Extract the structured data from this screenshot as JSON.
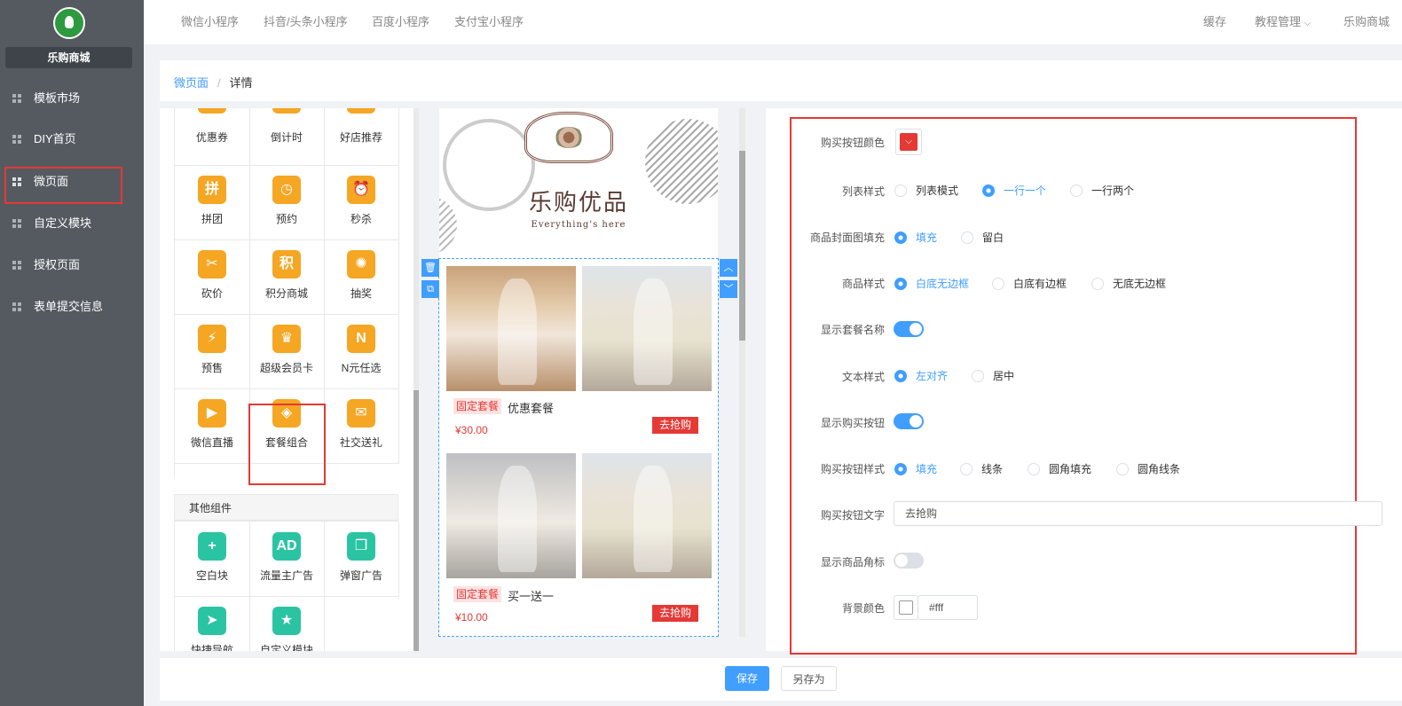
{
  "app": {
    "brand": "乐购商城"
  },
  "sidebar": {
    "items": [
      {
        "label": "模板市场"
      },
      {
        "label": "DIY首页"
      },
      {
        "label": "微页面"
      },
      {
        "label": "自定义模块"
      },
      {
        "label": "授权页面"
      },
      {
        "label": "表单提交信息"
      }
    ]
  },
  "topnav": {
    "tabs": [
      "微信小程序",
      "抖音/头条小程序",
      "百度小程序",
      "支付宝小程序"
    ],
    "right": [
      "缓存",
      "教程管理",
      "乐购商城"
    ]
  },
  "breadcrumb": {
    "link": "微页面",
    "sep": "/",
    "current": "详情"
  },
  "components": {
    "items": [
      {
        "label": "优惠券",
        "icon": "coupon-icon",
        "glyph": "¥",
        "color": "#f5a623"
      },
      {
        "label": "倒计时",
        "icon": "hourglass-icon",
        "glyph": "⧗",
        "color": "#f5a623"
      },
      {
        "label": "好店推荐",
        "icon": "shop-icon",
        "glyph": "⌂",
        "color": "#f5a623"
      },
      {
        "label": "拼团",
        "icon": "group-buy-icon",
        "glyph": "拼",
        "color": "#f5a623"
      },
      {
        "label": "预约",
        "icon": "calendar-clock-icon",
        "glyph": "◷",
        "color": "#f5a623"
      },
      {
        "label": "秒杀",
        "icon": "alarm-clock-icon",
        "glyph": "⏰",
        "color": "#f5a623"
      },
      {
        "label": "砍价",
        "icon": "price-tag-icon",
        "glyph": "✂",
        "color": "#f5a623"
      },
      {
        "label": "积分商城",
        "icon": "points-icon",
        "glyph": "积",
        "color": "#f5a623"
      },
      {
        "label": "抽奖",
        "icon": "lottery-wheel-icon",
        "glyph": "✺",
        "color": "#f5a623"
      },
      {
        "label": "预售",
        "icon": "presale-calendar-icon",
        "glyph": "⚡",
        "color": "#f5a623"
      },
      {
        "label": "超级会员卡",
        "icon": "crown-icon",
        "glyph": "♛",
        "color": "#f5a623"
      },
      {
        "label": "N元任选",
        "icon": "n-yuan-icon",
        "glyph": "N",
        "color": "#f5a623"
      },
      {
        "label": "微信直播",
        "icon": "live-tv-icon",
        "glyph": "▶",
        "color": "#f5a623"
      },
      {
        "label": "套餐组合",
        "icon": "combo-bag-icon",
        "glyph": "◈",
        "color": "#f5a623"
      },
      {
        "label": "社交送礼",
        "icon": "gift-icon",
        "glyph": "✉",
        "color": "#f5a623"
      }
    ],
    "other_title": "其他组件",
    "other_items": [
      {
        "label": "空白块",
        "icon": "blank-block-icon",
        "glyph": "+",
        "color": "#2bc4a3"
      },
      {
        "label": "流量主广告",
        "icon": "ad-icon",
        "glyph": "AD",
        "color": "#2bc4a3"
      },
      {
        "label": "弹窗广告",
        "icon": "popup-ad-icon",
        "glyph": "❐",
        "color": "#2bc4a3"
      },
      {
        "label": "快捷导航",
        "icon": "paper-plane-icon",
        "glyph": "➤",
        "color": "#2bc4a3"
      },
      {
        "label": "自定义模块",
        "icon": "custom-module-icon",
        "glyph": "★",
        "color": "#2bc4a3"
      }
    ]
  },
  "preview": {
    "banner_title": "乐购优品",
    "banner_sub": "Everything's here",
    "products": [
      {
        "tag": "固定套餐",
        "name": "优惠套餐",
        "price": "¥30.00",
        "buy": "去抢购"
      },
      {
        "tag": "固定套餐",
        "name": "买一送一",
        "price": "¥10.00",
        "buy": "去抢购"
      }
    ]
  },
  "settings": {
    "buy_btn_color_label": "购买按钮颜色",
    "buy_btn_color": "#e53935",
    "list_style_label": "列表样式",
    "list_style_options": [
      "列表模式",
      "一行一个",
      "一行两个"
    ],
    "cover_fill_label": "商品封面图填充",
    "cover_fill_options": [
      "填充",
      "留白"
    ],
    "goods_style_label": "商品样式",
    "goods_style_options": [
      "白底无边框",
      "白底有边框",
      "无底无边框"
    ],
    "show_name_label": "显示套餐名称",
    "show_name": true,
    "text_style_label": "文本样式",
    "text_style_options": [
      "左对齐",
      "居中"
    ],
    "show_buy_label": "显示购买按钮",
    "show_buy": true,
    "buy_style_label": "购买按钮样式",
    "buy_style_options": [
      "填充",
      "线条",
      "圆角填充",
      "圆角线条"
    ],
    "buy_text_label": "购买按钮文字",
    "buy_text_value": "去抢购",
    "show_badge_label": "显示商品角标",
    "show_badge": false,
    "bg_color_label": "背景颜色",
    "bg_color_value": "#fff"
  },
  "footer": {
    "save": "保存",
    "save_as": "另存为"
  }
}
